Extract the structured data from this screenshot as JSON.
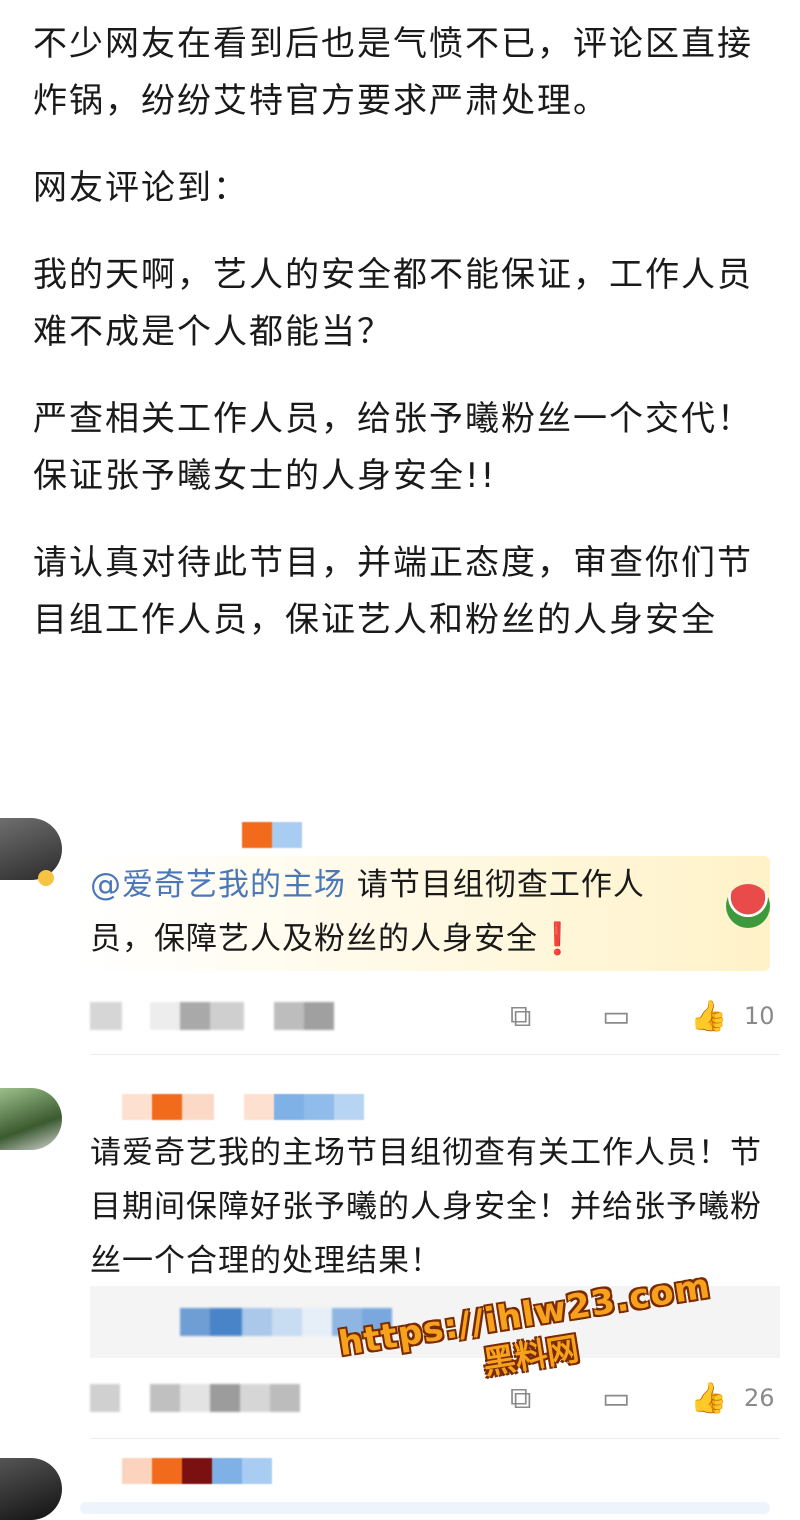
{
  "article": {
    "paragraphs": [
      "不少网友在看到后也是气愤不已，评论区直接炸锅，纷纷艾特官方要求严肃处理。",
      "网友评论到：",
      "我的天啊，艺人的安全都不能保证，工作人员难不成是个人都能当？",
      "严查相关工作人员，给张予曦粉丝一个交代！保证张予曦女士的人身安全!!",
      "请认真对待此节目，并端正态度，审查你们节目组工作人员，保证艺人和粉丝的人身安全"
    ]
  },
  "comments": [
    {
      "mention": "@爱奇艺我的主场",
      "text": " 请节目组彻查工作人员，保障艺人及粉丝的人身安全",
      "exclaim": "❗",
      "like_count": "10",
      "icons": {
        "share": "share-icon",
        "comment": "comment-icon",
        "like": "thumbs-up-icon"
      }
    },
    {
      "text": "请爱奇艺我的主场节目组彻查有关工作人员！节目期间保障好张予曦的人身安全！并给张予曦粉丝一个合理的处理结果！",
      "like_count": "26",
      "icons": {
        "share": "share-icon",
        "comment": "comment-icon",
        "like": "thumbs-up-icon"
      }
    }
  ],
  "watermark": {
    "url": "https://ihlw23.com",
    "name": "黑料网"
  },
  "colors": {
    "mention": "#4a78b8",
    "accent_orange": "#f6a21c",
    "icon_gray": "#8a8a8a"
  }
}
